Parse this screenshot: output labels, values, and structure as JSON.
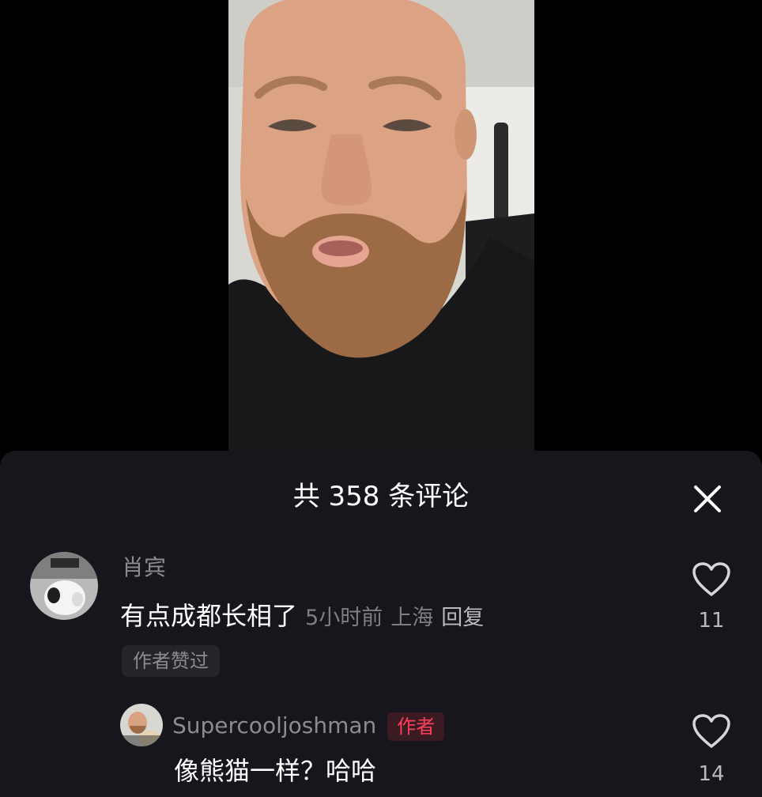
{
  "comments_panel": {
    "title": "共 358 条评论",
    "comments": [
      {
        "username": "肖宾",
        "text": "有点成都长相了",
        "time": "5小时前",
        "location": "上海",
        "reply_label": "回复",
        "liked_by_author_label": "作者赞过",
        "like_count": "11"
      }
    ],
    "replies": [
      {
        "username": "Supercooljoshman",
        "author_badge": "作者",
        "text": "像熊猫一样？哈哈",
        "like_count": "14"
      }
    ]
  },
  "icons": {
    "close": "close-icon",
    "like": "heart-outline-icon"
  },
  "colors": {
    "sheet_background": "#16161c",
    "author_badge": "#ff3f5b"
  }
}
